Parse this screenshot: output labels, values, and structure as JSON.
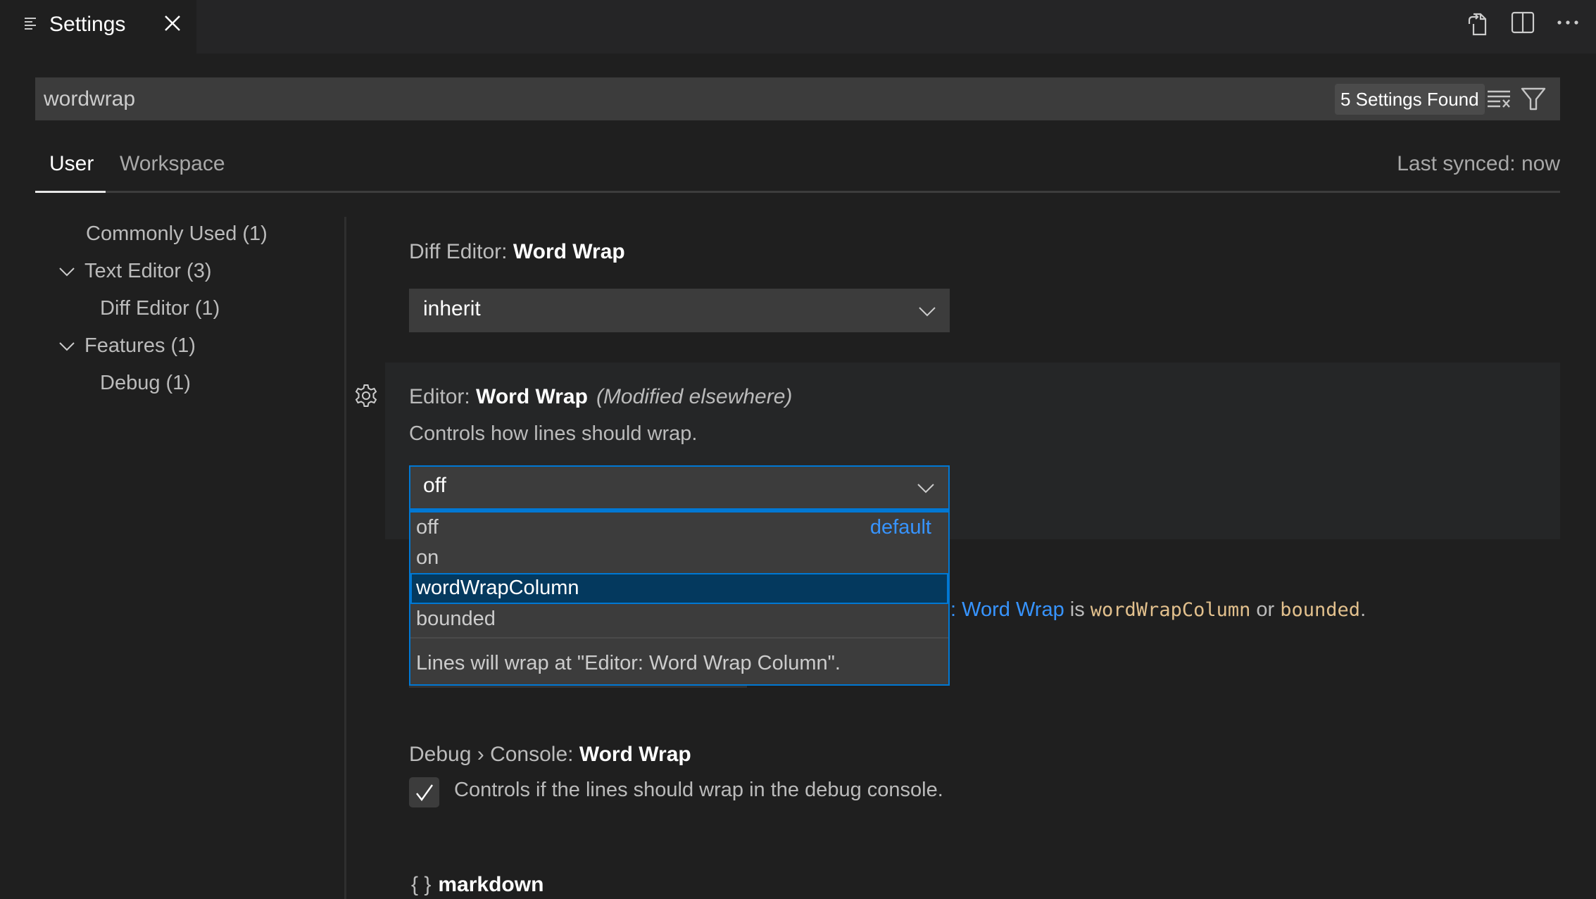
{
  "tab": {
    "title": "Settings",
    "icon": "settings-list-icon",
    "close_icon": "close-icon"
  },
  "tab_actions": [
    {
      "name": "open-settings-json-button",
      "icon": "go-to-file-icon"
    },
    {
      "name": "split-editor-button",
      "icon": "split-editor-icon"
    },
    {
      "name": "more-actions-button",
      "icon": "ellipsis-icon"
    }
  ],
  "search": {
    "value": "wordwrap",
    "placeholder": "Search settings",
    "results_badge": "5 Settings Found",
    "clear_icon": "clear-filter-icon",
    "filter_icon": "filter-icon"
  },
  "scope_tabs": {
    "user": "User",
    "workspace": "Workspace",
    "active": "User"
  },
  "sync_status": "Last synced: now",
  "toc": [
    {
      "label": "Commonly Used (1)",
      "level": 0,
      "expandable": false
    },
    {
      "label": "Text Editor (3)",
      "level": 0,
      "expandable": true,
      "expanded": true
    },
    {
      "label": "Diff Editor (1)",
      "level": 1,
      "expandable": false
    },
    {
      "label": "Features (1)",
      "level": 0,
      "expandable": true,
      "expanded": true
    },
    {
      "label": "Debug (1)",
      "level": 1,
      "expandable": false
    }
  ],
  "settings": {
    "diff_editor": {
      "category": "Diff Editor: ",
      "name": "Word Wrap",
      "value": "inherit"
    },
    "editor_word_wrap": {
      "category": "Editor: ",
      "name": "Word Wrap",
      "modified_note": "(Modified elsewhere)",
      "description": "Controls how lines should wrap.",
      "value": "off",
      "options": [
        {
          "label": "off",
          "badge": "default"
        },
        {
          "label": "on",
          "badge": ""
        },
        {
          "label": "wordWrapColumn",
          "badge": "",
          "highlighted": true
        },
        {
          "label": "bounded",
          "badge": ""
        }
      ],
      "option_description": "Lines will wrap at \"Editor: Word Wrap Column\"."
    },
    "obscured_description": {
      "link_prefix": ": ",
      "link": "Word Wrap",
      "text_is": " is ",
      "code1": "wordWrapColumn",
      "text_or": " or ",
      "code2": "bounded",
      "period": "."
    },
    "debug_console": {
      "category": "Debug › Console: ",
      "name": "Word Wrap",
      "description": "Controls if the lines should wrap in the debug console.",
      "checked": true
    },
    "markdown_group": {
      "brace": "{ }",
      "label": "markdown"
    }
  },
  "colors": {
    "accent": "#0078d4",
    "link": "#3794ff",
    "code": "#e2c08d",
    "selection": "#04395e",
    "background": "#1f1f1f"
  }
}
